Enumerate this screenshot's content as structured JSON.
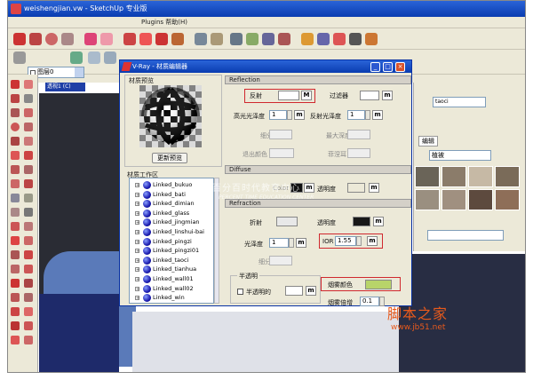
{
  "sketchup": {
    "title": "weishengjian.vw - SketchUp 专业版",
    "menu": "Plugins 帮助(H)",
    "layer_label": "图层0",
    "scene_tag": "透视1 (C)"
  },
  "materials_panel": {
    "name_value": "taoci",
    "tab_label": "编辑",
    "category_value": "植被"
  },
  "vray": {
    "title": "V-Ray - 材质编辑器",
    "left": {
      "preview_label": "材质预览",
      "refresh_button": "更新预览",
      "workspace_label": "材质工作区",
      "items": [
        "Linked_bukuo",
        "Linked_bati",
        "Linked_dimian",
        "Linked_glass",
        "Linked_jingmian",
        "Linked_linshui-bai",
        "Linked_pingzi",
        "Linked_pingzi01",
        "Linked_taoci",
        "Linked_tianhua",
        "Linked_wall01",
        "Linked_wall02",
        "Linked_win"
      ]
    },
    "reflection": {
      "section_label": "Reflection",
      "reflect_label": "反射",
      "map_button": "M",
      "filter_label": "过滤器",
      "m_button": "m",
      "hilight_gloss_label": "高光光泽度",
      "hilight_gloss_value": "1",
      "refl_gloss_label": "反射光泽度",
      "refl_gloss_value": "1",
      "subdiv_label": "细分",
      "max_depth_label": "最大深度",
      "exit_color_label": "退出颜色",
      "fresnel_label": "菲涅耳"
    },
    "diffuse": {
      "section_label": "Diffuse",
      "color_label": "Color",
      "m_button": "m",
      "transparency_label": "透明度",
      "m_button2": "m"
    },
    "refraction": {
      "section_label": "Refraction",
      "refract_label": "折射",
      "transparency_label": "透明度",
      "m_button": "m",
      "gloss_label": "光泽度",
      "gloss_value": "1",
      "ior_label": "IOR",
      "ior_value": "1.55",
      "subdiv_label": "细分",
      "translucent_group": "半透明",
      "translucent_check": "半透明的",
      "fog_color_label": "烟雾颜色",
      "fog_mult_label": "烟雾倍增",
      "fog_mult_value": "0.1"
    },
    "colors": {
      "reflect": "#ffffff",
      "filter": "#ffffff",
      "diffuse": "#101010",
      "refract": "#e8e8e8",
      "transparency": "#181818",
      "fog": "#b8d46a"
    }
  },
  "watermark": {
    "cn": "百分百时代教育中心",
    "en": "PERCENT TIME EDUCATION CENTER",
    "logo": "脚本之家",
    "url": "www.jb51.net"
  }
}
